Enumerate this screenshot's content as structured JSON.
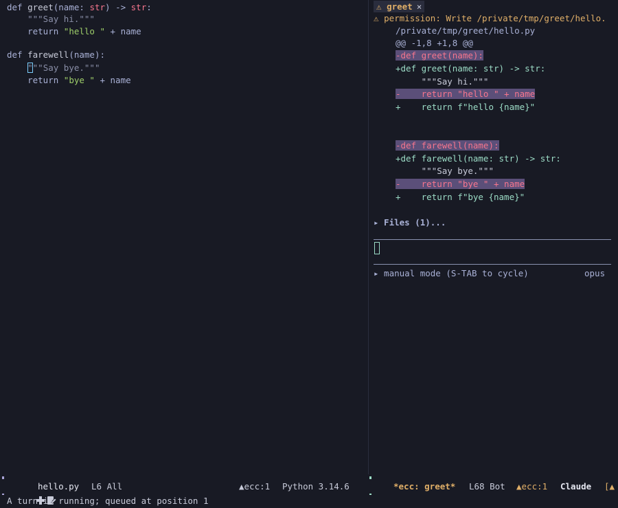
{
  "editor": {
    "lines": [
      {
        "kw": "def ",
        "name": "greet",
        "params": "(name: ",
        "type": "str",
        "tail": ") -> ",
        "ret": "str",
        "end": ":"
      },
      {
        "doc": "    \"\"\"Say hi.\"\"\""
      },
      {
        "indent": "    ",
        "kw": "return ",
        "str": "\"hello \"",
        "tail": " + name"
      },
      {
        "blank": ""
      },
      {
        "kw": "def ",
        "name": "farewell",
        "params": "(name):"
      },
      {
        "doc_cursor": "\"",
        "doc_rest": "\"\"Say bye.\"\"\""
      },
      {
        "indent": "    ",
        "kw": "return ",
        "str": "\"bye \"",
        "tail": " + name"
      }
    ]
  },
  "claude_pane": {
    "tab": {
      "icon": "warning-icon",
      "label": "greet",
      "close": "×"
    },
    "permission_line": "permission: Write /private/tmp/greet/hello.",
    "file_path": "/private/tmp/greet/hello.py",
    "hunk_header": "@@ -1,8 +1,8 @@",
    "diff": [
      {
        "kind": "del",
        "text": "-def greet(name):"
      },
      {
        "kind": "add",
        "text": "+def greet(name: str) -> str:"
      },
      {
        "kind": "ctx",
        "text": "     \"\"\"Say hi.\"\"\""
      },
      {
        "kind": "del",
        "text": "-    return \"hello \" + name"
      },
      {
        "kind": "add",
        "text": "+    return f\"hello {name}\""
      },
      {
        "kind": "blank",
        "text": ""
      },
      {
        "kind": "blank",
        "text": ""
      },
      {
        "kind": "del",
        "text": "-def farewell(name):"
      },
      {
        "kind": "add",
        "text": "+def farewell(name: str) -> str:"
      },
      {
        "kind": "ctx",
        "text": "     \"\"\"Say bye.\"\"\""
      },
      {
        "kind": "del",
        "text": "-    return \"bye \" + name"
      },
      {
        "kind": "add",
        "text": "+    return f\"bye {name}\""
      }
    ],
    "files_toggle": "▸ Files (1)...",
    "mode_text": "▸ manual mode (S-TAB to cycle)",
    "model": "opus"
  },
  "left_status": {
    "filename": "hello.py",
    "position": "L6 All",
    "diagnostics": "ecc:1",
    "language": "Python 3.14.6"
  },
  "right_status": {
    "buffer": "*ecc: greet*",
    "position": "L68 Bot",
    "diagnostics": "ecc:1",
    "mode": "Claude",
    "overflow": "[▲"
  },
  "echo_area": "A turn is running; queued at position 1",
  "colors": {
    "background": "#181a24",
    "warning": "#e0af68",
    "deleted": "#f7768e",
    "deleted_bg": "#5b4f79",
    "added": "#9cdcc6",
    "string": "#9ece6a"
  }
}
